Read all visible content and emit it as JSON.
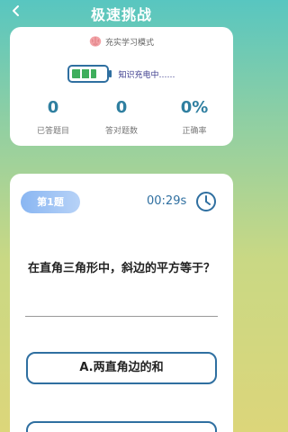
{
  "header": {
    "title": "极速挑战",
    "back_icon": "chevron-left-icon"
  },
  "stats_card": {
    "mode_icon": "brain-icon",
    "mode_text": "充实学习模式",
    "battery_icon": "battery-icon",
    "charge_text": "知识充电中……",
    "battery_level": 0.75,
    "stats": [
      {
        "value": "0",
        "label": "已答题目"
      },
      {
        "value": "0",
        "label": "答对题数"
      },
      {
        "value": "0%",
        "label": "正确率"
      }
    ]
  },
  "question_card": {
    "badge": "第1题",
    "timer": "00:29s",
    "timer_icon": "clock-icon",
    "question": "在直角三角形中，斜边的平方等于？",
    "options": [
      {
        "label": "A.两直角边的和"
      },
      {
        "label": ""
      }
    ]
  },
  "colors": {
    "accent": "#2f6fa0",
    "badge": "#89b6f2",
    "battery": "#3fae5c",
    "title": "#ffffff"
  }
}
